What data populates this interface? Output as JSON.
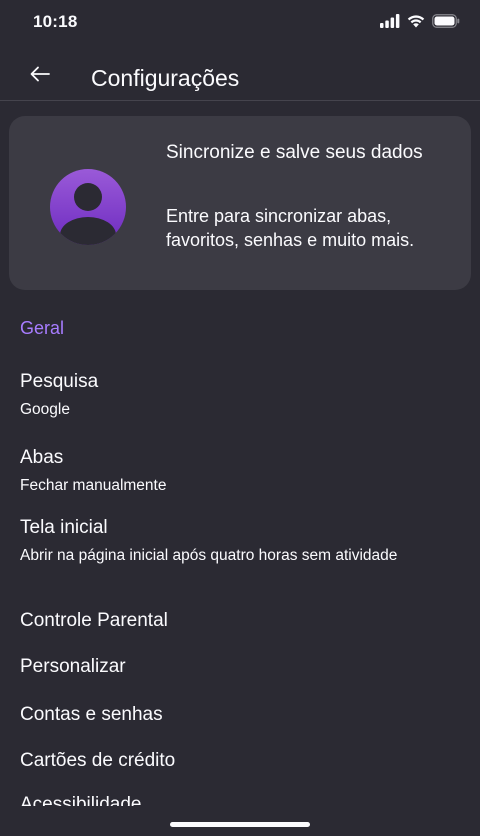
{
  "status": {
    "time": "10:18"
  },
  "app_bar": {
    "title": "Configurações"
  },
  "account": {
    "title": "Sincronize e salve seus dados",
    "subtitle": "Entre para sincronizar abas, favoritos, senhas e muito mais."
  },
  "sections": {
    "general": "Geral"
  },
  "settings": [
    {
      "title": "Pesquisa",
      "subtitle": "Google"
    },
    {
      "title": "Abas",
      "subtitle": "Fechar manualmente"
    },
    {
      "title": "Tela inicial",
      "subtitle": "Abrir na página inicial após quatro horas sem atividade"
    },
    {
      "title": "Controle Parental"
    },
    {
      "title": "Personalizar"
    },
    {
      "title": "Contas e senhas"
    },
    {
      "title": "Cartões de crédito"
    },
    {
      "title": "Acessibilidade"
    }
  ],
  "colors": {
    "background": "#2b2a33",
    "card": "#3c3b44",
    "accent": "#a77cff",
    "text": "#fbfbfe"
  },
  "icons": {
    "back": "arrow-left-icon",
    "avatar": "account-avatar-icon",
    "signal": "cellular-signal-icon",
    "wifi": "wifi-icon",
    "battery": "battery-icon"
  }
}
